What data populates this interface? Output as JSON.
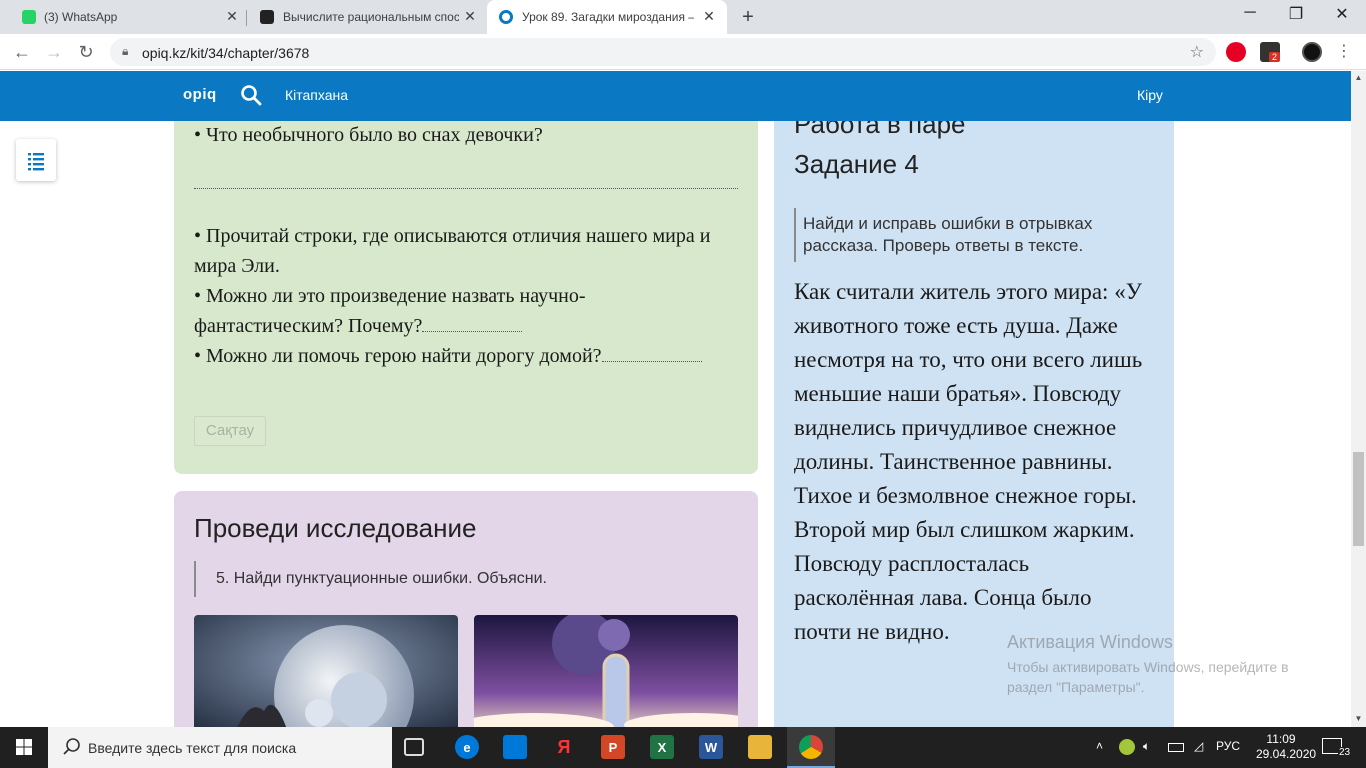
{
  "browser": {
    "tabs": [
      {
        "title": "(3) WhatsApp",
        "active": false
      },
      {
        "title": "Вычислите рациональным спос",
        "active": false
      },
      {
        "title": "Урок 89. Загадки мироздания –",
        "active": true
      }
    ],
    "url": "opiq.kz/kit/34/chapter/3678",
    "extension_badge": "2"
  },
  "site": {
    "logo": "opiq",
    "nav_library": "Кітапхана",
    "login": "Кіру"
  },
  "green_block": {
    "question1": "• Что необычного было во снах девочки?",
    "line1": "• Прочитай строки, где описываются отличия нашего мира и мира Эли.",
    "line2": "• Можно ли это произведение назвать научно-фантастическим? Почему?",
    "line3": "• Можно ли помочь герою найти дорогу домой?",
    "save_label": "Сақтау"
  },
  "research_block": {
    "title": "Проведи исследование",
    "task": "5. Найди пунктуационные ошибки. Объясни."
  },
  "pair_block": {
    "heading": "Работа в паре",
    "task_title": "Задание 4",
    "instruction": "Найди и исправь ошибки в отрывках рассказа. Проверь ответы в тексте.",
    "story": "Как считали житель этого мира: «У животного тоже есть душа. Даже несмотря на то, что они всего лишь меньшие наши братья». Повсюду виднелись причудливое снежное долины. Таинственное равнины. Тихое и безмолвное снежное горы. Второй мир был слишком жарким. Повсюду расплосталась расколённая лава. Сонца было почти не видно."
  },
  "watermark": {
    "title": "Активация Windows",
    "text": "Чтобы активировать Windows, перейдите в раздел \"Параметры\"."
  },
  "taskbar": {
    "search_placeholder": "Введите здесь текст для поиска",
    "language": "РУС",
    "time": "11:09",
    "date": "29.04.2020",
    "notifications": "23"
  }
}
